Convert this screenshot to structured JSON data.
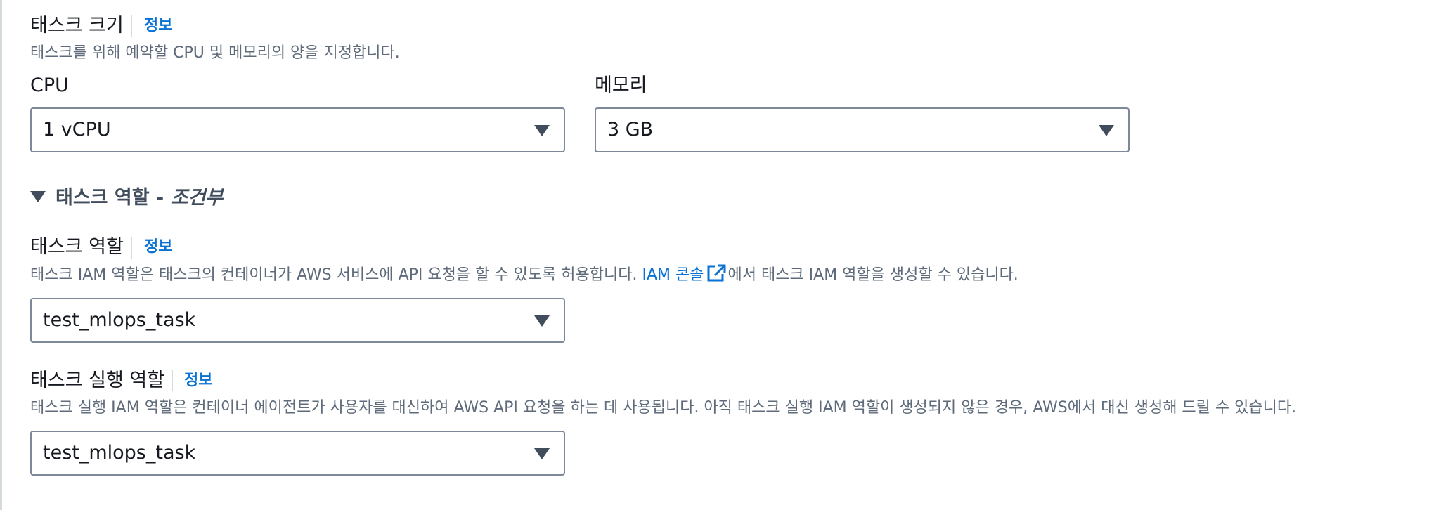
{
  "task_size": {
    "heading": "태스크 크기",
    "info": "정보",
    "description": "태스크를 위해 예약할 CPU 및 메모리의 양을 지정합니다.",
    "cpu": {
      "label": "CPU",
      "value": "1 vCPU"
    },
    "memory": {
      "label": "메모리",
      "value": "3 GB"
    }
  },
  "task_role_section": {
    "toggle_title": "태스크 역할",
    "toggle_separator": " - ",
    "toggle_optional": "조건부",
    "task_role": {
      "heading": "태스크 역할",
      "info": "정보",
      "description_before": "태스크 IAM 역할은 태스크의 컨테이너가 AWS 서비스에 API 요청을 할 수 있도록 허용합니다. ",
      "iam_console_link": "IAM 콘솔",
      "description_after": "에서 태스크 IAM 역할을 생성할 수 있습니다.",
      "value": "test_mlops_task"
    },
    "execution_role": {
      "heading": "태스크 실행 역할",
      "info": "정보",
      "description": "태스크 실행 IAM 역할은 컨테이너 에이전트가 사용자를 대신하여 AWS API 요청을 하는 데 사용됩니다. 아직 태스크 실행 IAM 역할이 생성되지 않은 경우, AWS에서 대신 생성해 드릴 수 있습니다.",
      "value": "test_mlops_task"
    }
  },
  "icons": {
    "dropdown": "caret-down-icon",
    "expander": "caret-down-icon",
    "external_link": "external-link-icon"
  },
  "colors": {
    "link": "#0972d3",
    "text": "#16191f",
    "secondary_text": "#5f6b7a",
    "border": "#7d8998"
  }
}
